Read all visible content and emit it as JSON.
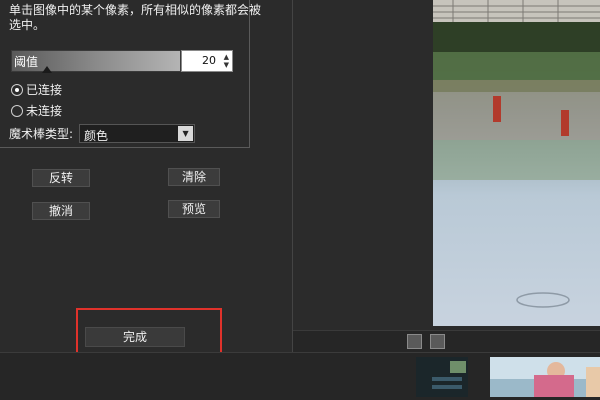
{
  "instruction": "单击图像中的某个像素，所有相似的像素都会被选中。",
  "threshold": {
    "label": "阈值",
    "value": "20"
  },
  "connection": {
    "connected_label": "已连接",
    "unconnected_label": "未连接",
    "selected": "connected"
  },
  "wand_type": {
    "label": "魔术棒类型:",
    "value": "颜色"
  },
  "buttons": {
    "invert": "反转",
    "clear": "清除",
    "undo": "撤消",
    "preview": "预览",
    "done": "完成"
  },
  "colors": {
    "background": "#2b2b2b",
    "highlight": "#e0322b",
    "button": "#3c3c3c"
  },
  "icons": {
    "fit": "fit-to-window-icon",
    "histogram": "histogram-icon",
    "spin": "spin-arrows-icon",
    "dropdown": "chevron-down-icon"
  }
}
